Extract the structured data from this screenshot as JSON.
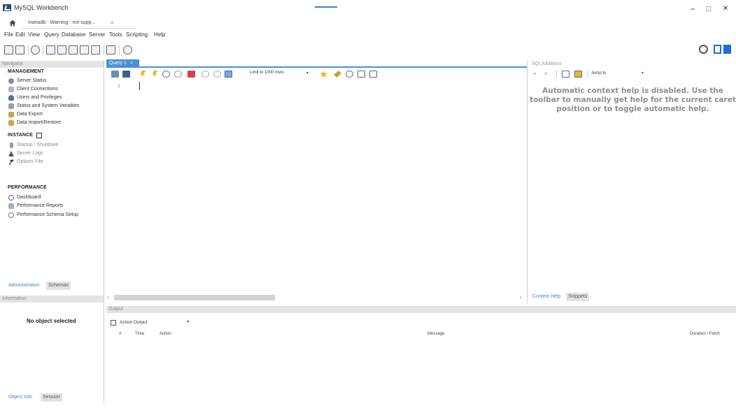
{
  "window": {
    "title": "MySQL Workbench",
    "minimize_glyph": "−",
    "maximize_glyph": "□",
    "close_glyph": "✕"
  },
  "connection_tab": {
    "label": "mariadb - Warning - not supp...",
    "close_glyph": "×"
  },
  "menu": [
    "File",
    "Edit",
    "View",
    "Query",
    "Database",
    "Server",
    "Tools",
    "Scripting",
    "Help"
  ],
  "navigator": {
    "header": "Navigator",
    "sections": {
      "management": {
        "title": "MANAGEMENT",
        "items": [
          "Server Status",
          "Client Connections",
          "Users and Privileges",
          "Status and System Variables",
          "Data Export",
          "Data Import/Restore"
        ]
      },
      "instance": {
        "title": "INSTANCE",
        "items": [
          "Startup / Shutdown",
          "Server Logs",
          "Options File"
        ]
      },
      "performance": {
        "title": "PERFORMANCE",
        "items": [
          "Dashboard",
          "Performance Reports",
          "Performance Schema Setup"
        ]
      }
    },
    "tabs": [
      "Administration",
      "Schemas"
    ]
  },
  "information": {
    "header": "Information",
    "empty_text": "No object selected",
    "tabs": [
      "Object Info",
      "Session"
    ]
  },
  "editor": {
    "tab_label": "Query 1",
    "tab_close": "×",
    "limit_label": "Limit to 1000 rows",
    "line_number": "1"
  },
  "sql_additions": {
    "header": "SQLAdditions",
    "jump_to": "Jump to",
    "help_text": "Automatic context help is disabled. Use the toolbar to manually get help for the current caret position or to toggle automatic help.",
    "tabs": [
      "Context Help",
      "Snippets"
    ]
  },
  "output": {
    "header": "Output",
    "selector": "Action Output",
    "columns": [
      "#",
      "Time",
      "Action",
      "Message",
      "Duration / Fetch"
    ]
  },
  "colors": {
    "accent": "#4a90d9",
    "panel_header": "#e4e4e4",
    "help_text": "#8e8e8e"
  }
}
